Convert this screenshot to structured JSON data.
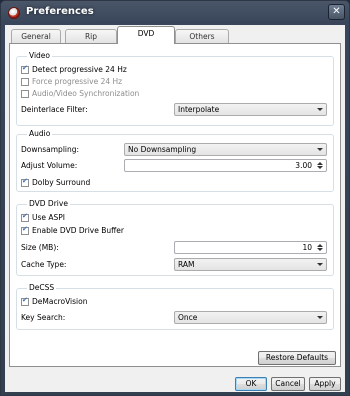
{
  "window": {
    "title": "Preferences",
    "close_glyph": "✕"
  },
  "tabs": [
    {
      "label": "General",
      "active": false
    },
    {
      "label": "Rip",
      "active": false
    },
    {
      "label": "DVD",
      "active": true
    },
    {
      "label": "Others",
      "active": false
    }
  ],
  "video": {
    "title": "Video",
    "detect_progressive": {
      "label": "Detect progressive 24 Hz",
      "checked": true
    },
    "force_progressive": {
      "label": "Force progressive 24 Hz",
      "checked": false,
      "enabled": false
    },
    "av_sync": {
      "label": "Audio/Video Synchronization",
      "checked": false,
      "enabled": false
    },
    "deinterlace_label": "Deinterlace Filter:",
    "deinterlace_value": "Interpolate"
  },
  "audio": {
    "title": "Audio",
    "downsampling_label": "Downsampling:",
    "downsampling_value": "No Downsampling",
    "volume_label": "Adjust Volume:",
    "volume_value": "3.00",
    "dolby": {
      "label": "Dolby Surround",
      "checked": true
    }
  },
  "dvd_drive": {
    "title": "DVD Drive",
    "use_aspi": {
      "label": "Use ASPI",
      "checked": true
    },
    "drive_buffer": {
      "label": "Enable DVD Drive Buffer",
      "checked": true
    },
    "size_label": "Size (MB):",
    "size_value": "10",
    "cache_label": "Cache Type:",
    "cache_value": "RAM"
  },
  "decss": {
    "title": "DeCSS",
    "demacro": {
      "label": "DeMacroVision",
      "checked": true
    },
    "key_search_label": "Key Search:",
    "key_search_value": "Once"
  },
  "buttons": {
    "restore": "Restore Defaults",
    "ok": "OK",
    "cancel": "Cancel",
    "apply": "Apply"
  },
  "icons": {
    "app": "dvd-disc-icon",
    "close": "close-icon",
    "dropdown": "chevron-down-icon",
    "spin": "spin-arrows-icon"
  }
}
